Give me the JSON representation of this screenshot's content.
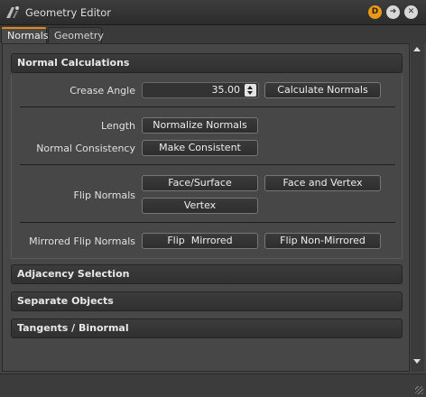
{
  "window": {
    "title": "Geometry Editor"
  },
  "titlebar": {
    "badge_label": "D",
    "arrow_glyph": "➜",
    "close_glyph": "✕"
  },
  "tabs": [
    {
      "label": "Normals",
      "active": true
    },
    {
      "label": "Geometry",
      "active": false
    }
  ],
  "sections": {
    "normal_calculations": "Normal Calculations",
    "adjacency_selection": "Adjacency Selection",
    "separate_objects": "Separate Objects",
    "tangents_binormal": "Tangents / Binormal"
  },
  "crease_angle": {
    "label": "Crease Angle",
    "value": "35.00",
    "button": "Calculate Normals"
  },
  "length": {
    "label": "Length",
    "button": "Normalize Normals"
  },
  "consistency": {
    "label": "Normal Consistency",
    "button": "Make Consistent"
  },
  "flip_normals": {
    "label": "Flip Normals",
    "face_surface": "Face/Surface",
    "face_vertex": "Face and Vertex",
    "vertex": "Vertex"
  },
  "mirrored": {
    "label": "Mirrored Flip Normals",
    "flip_mirrored": "Flip  Mirrored",
    "flip_non_mirrored": "Flip Non-Mirrored"
  },
  "colors": {
    "accent": "#e08a1e",
    "badge": "#e89b1a",
    "panel": "#474747"
  }
}
